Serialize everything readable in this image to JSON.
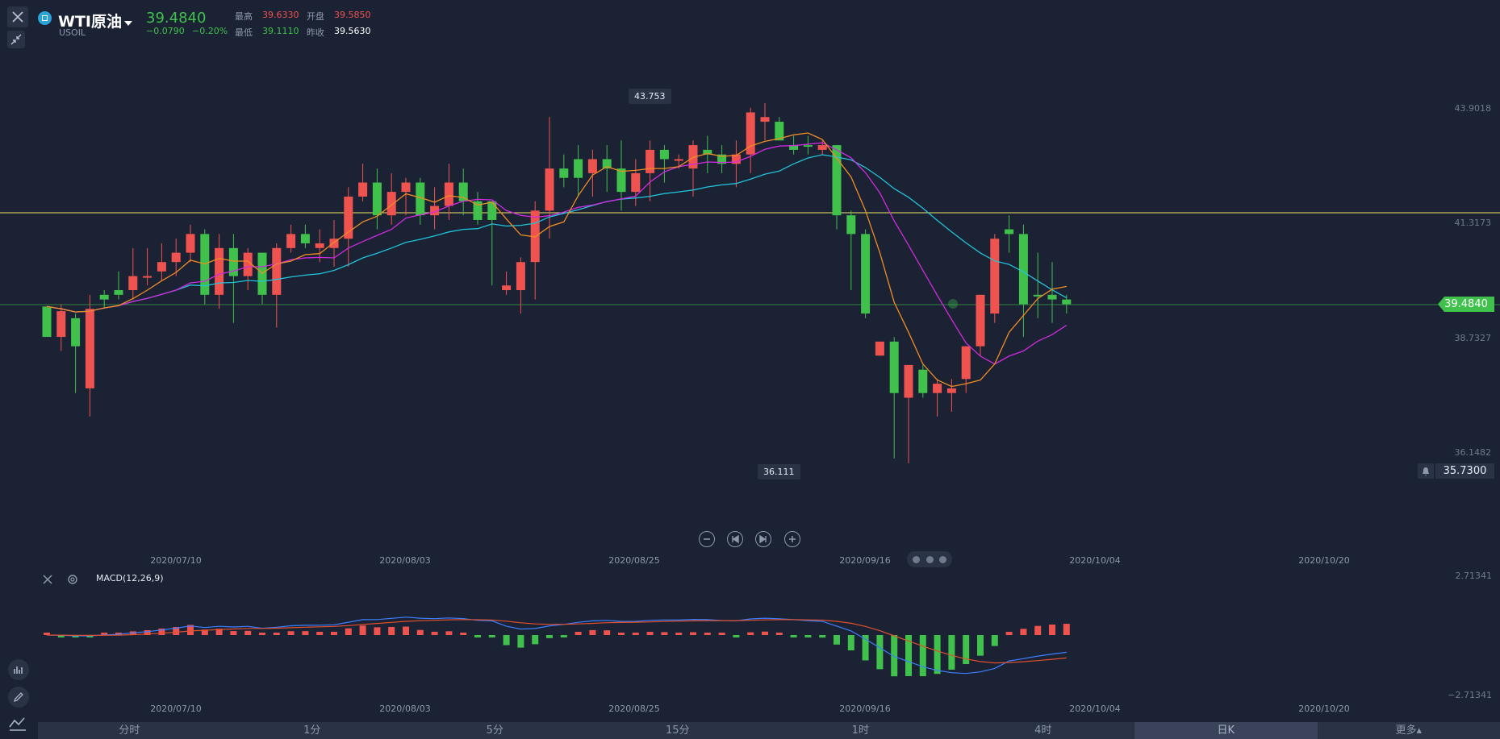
{
  "header": {
    "symbol_name": "WTI原油",
    "symbol_code": "USOIL",
    "price": "39.4840",
    "change": "−0.0790",
    "change_pct": "−0.20%",
    "high_label": "最高",
    "high_value": "39.6330",
    "open_label": "开盘",
    "open_value": "39.5850",
    "low_label": "最低",
    "low_value": "39.1110",
    "prev_close_label": "昨收",
    "prev_close_value": "39.5630"
  },
  "colors": {
    "up": "#ef5350",
    "down": "#3fc14c",
    "ma_fast": "#f08c24",
    "ma_mid": "#d02be0",
    "ma_slow": "#22c3d9",
    "ref_line": "#f2e46e",
    "macd_line": "#3d7fff",
    "signal_line": "#e0502e"
  },
  "price_axis": [
    "43.9018",
    "41.3173",
    "38.7327",
    "36.1482"
  ],
  "current_price_tag": "39.4840",
  "alert_price": "35.7300",
  "peak_tag": "43.753",
  "trough_tag": "36.111",
  "date_labels": [
    "2020/07/10",
    "2020/08/03",
    "2020/08/25",
    "2020/09/16",
    "2020/10/04",
    "2020/10/20"
  ],
  "macd": {
    "label": "MACD(12,26,9)",
    "axis_top": "2.71341",
    "axis_bottom": "−2.71341"
  },
  "periods": [
    "分时",
    "1分",
    "5分",
    "15分",
    "1时",
    "4时",
    "日K",
    "更多▴"
  ],
  "active_period": "日K",
  "chart_data": {
    "type": "candlestick",
    "candles": [
      [
        38.7,
        39.35,
        38.9,
        39.1,
        "g"
      ],
      [
        38.7,
        39.25,
        38.4,
        39.4,
        "r"
      ],
      [
        38.5,
        39.1,
        37.5,
        39.2,
        "g"
      ],
      [
        37.6,
        39.3,
        37.0,
        39.6,
        "r"
      ],
      [
        39.5,
        39.6,
        39.3,
        39.7,
        "g"
      ],
      [
        39.7,
        39.6,
        39.5,
        40.1,
        "g"
      ],
      [
        39.7,
        40.0,
        39.5,
        40.6,
        "r"
      ],
      [
        40.0,
        40.0,
        39.8,
        40.6,
        "r"
      ],
      [
        40.1,
        40.3,
        39.9,
        40.7,
        "r"
      ],
      [
        40.3,
        40.5,
        40.0,
        40.8,
        "r"
      ],
      [
        40.5,
        40.9,
        40.3,
        41.1,
        "r"
      ],
      [
        40.9,
        39.6,
        39.4,
        41.0,
        "g"
      ],
      [
        39.6,
        40.6,
        39.3,
        40.9,
        "r"
      ],
      [
        40.6,
        40.0,
        39.0,
        40.9,
        "g"
      ],
      [
        40.0,
        40.5,
        39.7,
        40.6,
        "r"
      ],
      [
        40.5,
        39.6,
        39.4,
        40.5,
        "g"
      ],
      [
        39.6,
        40.6,
        38.9,
        40.7,
        "r"
      ],
      [
        40.6,
        40.9,
        40.5,
        41.1,
        "r"
      ],
      [
        40.9,
        40.7,
        40.6,
        41.1,
        "g"
      ],
      [
        40.7,
        40.6,
        40.3,
        41.0,
        "r"
      ],
      [
        40.6,
        40.8,
        40.2,
        41.2,
        "r"
      ],
      [
        40.8,
        41.7,
        40.2,
        41.9,
        "r"
      ],
      [
        41.7,
        42.0,
        41.6,
        42.4,
        "r"
      ],
      [
        42.0,
        41.3,
        41.0,
        42.3,
        "g"
      ],
      [
        41.3,
        41.8,
        41.1,
        42.2,
        "r"
      ],
      [
        41.8,
        42.0,
        41.3,
        42.1,
        "r"
      ],
      [
        42.0,
        41.3,
        41.1,
        42.1,
        "g"
      ],
      [
        41.3,
        41.5,
        41.0,
        41.9,
        "r"
      ],
      [
        41.5,
        42.0,
        41.2,
        42.4,
        "r"
      ],
      [
        42.0,
        41.6,
        41.3,
        42.3,
        "g"
      ],
      [
        41.6,
        41.2,
        41.1,
        41.8,
        "g"
      ],
      [
        41.2,
        41.6,
        39.8,
        41.5,
        "g"
      ],
      [
        39.8,
        39.7,
        39.6,
        40.1,
        "r"
      ],
      [
        39.7,
        40.3,
        39.2,
        40.4,
        "r"
      ],
      [
        40.3,
        41.4,
        39.5,
        41.6,
        "r"
      ],
      [
        41.4,
        42.3,
        40.8,
        43.4,
        "r"
      ],
      [
        42.3,
        42.1,
        41.9,
        42.6,
        "g"
      ],
      [
        42.1,
        42.5,
        41.7,
        42.8,
        "g"
      ],
      [
        42.2,
        42.5,
        41.7,
        42.7,
        "r"
      ],
      [
        42.5,
        42.3,
        41.8,
        42.8,
        "g"
      ],
      [
        42.3,
        41.8,
        41.4,
        42.9,
        "g"
      ],
      [
        41.8,
        42.2,
        41.5,
        42.5,
        "r"
      ],
      [
        42.2,
        42.7,
        41.6,
        42.9,
        "r"
      ],
      [
        42.7,
        42.5,
        42.0,
        42.8,
        "g"
      ],
      [
        42.5,
        42.5,
        42.3,
        42.6,
        "r"
      ],
      [
        42.3,
        42.8,
        41.7,
        42.9,
        "r"
      ],
      [
        42.7,
        42.6,
        42.2,
        43.0,
        "g"
      ],
      [
        42.6,
        42.4,
        42.2,
        42.8,
        "g"
      ],
      [
        42.4,
        42.6,
        41.9,
        42.9,
        "r"
      ],
      [
        42.6,
        43.5,
        42.2,
        43.6,
        "r"
      ],
      [
        43.4,
        43.3,
        42.9,
        43.7,
        "r"
      ],
      [
        43.3,
        42.9,
        42.9,
        43.4,
        "g"
      ],
      [
        42.7,
        42.8,
        42.6,
        43.0,
        "g"
      ],
      [
        42.8,
        42.8,
        42.6,
        43.0,
        "g"
      ],
      [
        42.7,
        42.8,
        42.6,
        42.9,
        "r"
      ],
      [
        42.8,
        41.3,
        41.0,
        42.8,
        "g"
      ],
      [
        41.3,
        40.9,
        39.7,
        41.4,
        "g"
      ],
      [
        40.9,
        39.2,
        39.1,
        41.0,
        "g"
      ],
      [
        38.6,
        38.3,
        38.3,
        38.5,
        "r"
      ],
      [
        38.6,
        37.5,
        36.1,
        38.7,
        "g"
      ],
      [
        37.4,
        38.1,
        36.0,
        37.8,
        "r"
      ],
      [
        38.0,
        37.5,
        37.4,
        38.1,
        "g"
      ],
      [
        37.7,
        37.5,
        37.0,
        37.8,
        "r"
      ],
      [
        37.5,
        37.6,
        37.1,
        37.8,
        "r"
      ],
      [
        38.5,
        37.8,
        37.5,
        38.5,
        "r"
      ],
      [
        39.6,
        38.5,
        38.3,
        39.6,
        "r"
      ],
      [
        40.8,
        39.2,
        39.0,
        40.9,
        "r"
      ],
      [
        41.0,
        40.9,
        40.5,
        41.3,
        "g"
      ],
      [
        40.9,
        39.4,
        38.7,
        41.1,
        "g"
      ],
      [
        39.6,
        39.6,
        39.1,
        40.5,
        "g"
      ],
      [
        39.6,
        39.5,
        39.0,
        40.3,
        "g"
      ],
      [
        39.4,
        39.5,
        39.2,
        39.6,
        "g"
      ]
    ],
    "markers": {
      "peak": "43.753",
      "trough": "36.111"
    },
    "ylim": [
      35.6,
      44.8
    ]
  }
}
